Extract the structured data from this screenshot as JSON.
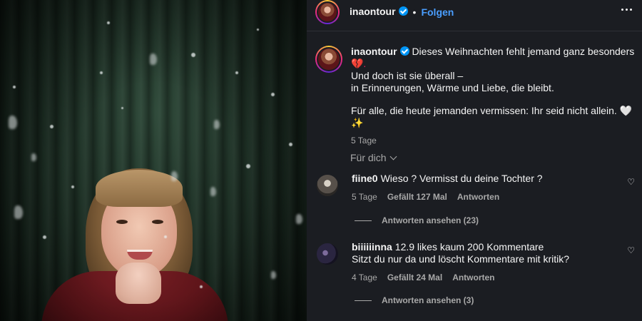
{
  "post": {
    "username": "inaontour",
    "follow_label": "Folgen",
    "separator": "•"
  },
  "caption": {
    "username": "inaontour",
    "line1": "Dieses Weihnachten fehlt jemand ganz besonders",
    "line1_emoji": "💔.",
    "line2": "Und doch ist sie überall –",
    "line3": "in Erinnerungen, Wärme und Liebe, die bleibt.",
    "line4": "Für alle, die heute jemanden vermissen: Ihr seid nicht allein.",
    "line4_emoji": "🤍✨",
    "time": "5 Tage"
  },
  "sort_label": "Für dich",
  "comments": [
    {
      "username": "fiine0",
      "text": "Wieso ? Vermisst du deine Tochter ?",
      "time": "5 Tage",
      "likes": "Gefällt 127 Mal",
      "reply_label": "Antworten",
      "view_replies": "Antworten ansehen (23)"
    },
    {
      "username": "biiiiiinna",
      "text": "12.9 likes kaum 200 Kommentare",
      "text2": "Sitzt du nur da und löscht Kommentare mit kritik?",
      "time": "4 Tage",
      "likes": "Gefällt 24 Mal",
      "reply_label": "Antworten",
      "view_replies": "Antworten ansehen (3)"
    }
  ],
  "icons": {
    "verified": "verified-badge-icon",
    "more": "more-options-icon",
    "like": "heart-outline-icon",
    "chevron": "chevron-down-icon"
  },
  "colors": {
    "panel_bg": "#1b1d22",
    "link_blue": "#4a9eff",
    "muted": "#a8a8a8"
  }
}
